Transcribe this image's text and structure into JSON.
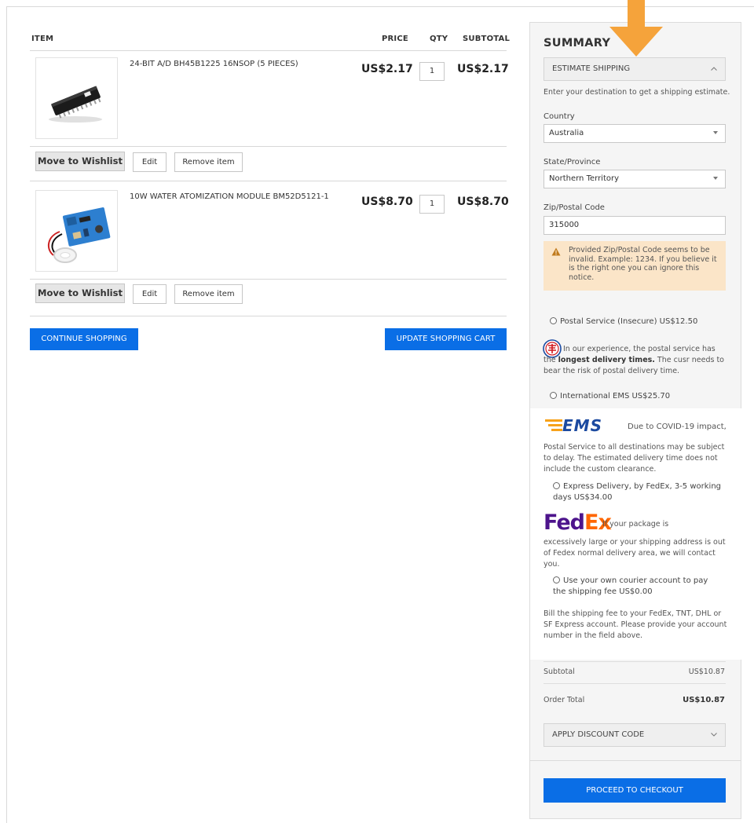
{
  "cart": {
    "headers": {
      "item": "ITEM",
      "price": "PRICE",
      "qty": "QTY",
      "subtotal": "SUBTOTAL"
    },
    "items": [
      {
        "name": "24-BIT A/D BH45B1225 16NSOP (5 PIECES)",
        "price": "US$2.17",
        "qty": "1",
        "subtotal": "US$2.17",
        "wishlist_label": "Move to Wishlist",
        "edit_label": "Edit",
        "remove_label": "Remove item"
      },
      {
        "name": "10W WATER ATOMIZATION MODULE BM52D5121-1",
        "price": "US$8.70",
        "qty": "1",
        "subtotal": "US$8.70",
        "wishlist_label": "Move to Wishlist",
        "edit_label": "Edit",
        "remove_label": "Remove item"
      }
    ],
    "continue_label": "CONTINUE SHOPPING",
    "update_label": "UPDATE SHOPPING CART"
  },
  "summary": {
    "title": "SUMMARY",
    "estimate_label": "ESTIMATE SHIPPING",
    "estimate_hint": "Enter your destination to get a shipping estimate.",
    "country_label": "Country",
    "country_value": "Australia",
    "state_label": "State/Province",
    "state_value": "Northern Territory",
    "zip_label": "Zip/Postal Code",
    "zip_value": "315000",
    "warning": "Provided Zip/Postal Code seems to be invalid. Example: 1234. If you believe it is the right one you can ignore this notice.",
    "options": {
      "postal": "Postal Service (Insecure) US$12.50",
      "postal_note_pre": "In our experience, the postal service has the ",
      "postal_note_bold": "longest delivery times.",
      "postal_note_post": " The cusr needs to bear the risk of postal delivery time.",
      "ems": "International EMS US$25.70",
      "ems_logo": "EMS",
      "ems_note_first": "Due to COVID-19 impact,",
      "ems_note_rest": "Postal Service to all destinations may be subject to delay. The estimated delivery time does not include the custom clearance.",
      "fedex": "Express Delivery, by FedEx, 3-5 working days US$34.00",
      "fedex_logo_fed": "Fed",
      "fedex_logo_ex": "Ex",
      "fedex_note_first": "If your package is",
      "fedex_note_rest": "excessively large or your shipping address is out of Fedex normal delivery area, we will contact you.",
      "own": "Use your own courier account to pay the shipping fee US$0.00",
      "own_note": "Bill the shipping fee to your FedEx, TNT, DHL or SF Express account. Please provide your account number in the field above."
    },
    "subtotal_label": "Subtotal",
    "subtotal_value": "US$10.87",
    "order_total_label": "Order Total",
    "order_total_value": "US$10.87",
    "discount_label": "APPLY DISCOUNT CODE",
    "checkout_label": "PROCEED TO CHECKOUT"
  },
  "colors": {
    "primary_button": "#0a6ee6",
    "annotation_arrow": "#f5a33b",
    "warning_bg": "#fbe5c8",
    "fedex_purple": "#4d148c",
    "fedex_orange": "#ff6600"
  }
}
